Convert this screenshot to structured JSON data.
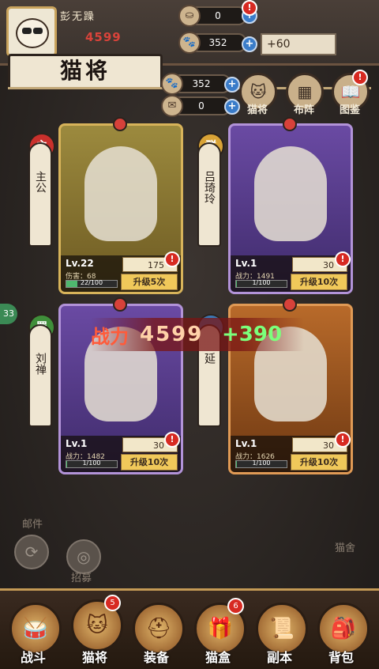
{
  "player": {
    "name": "彭无躁",
    "power": "4599"
  },
  "resources_top": [
    {
      "icon": "currency-icon",
      "value": "0"
    },
    {
      "icon": "cat-coin-icon",
      "value": "352"
    }
  ],
  "gain_text": "+60",
  "page_title": "猫将",
  "resources_mid": [
    {
      "icon": "cat-coin-icon",
      "value": "352"
    },
    {
      "icon": "scroll-icon",
      "value": "0"
    }
  ],
  "menu": [
    {
      "label": "猫将",
      "icon": "cat-head-icon"
    },
    {
      "label": "布阵",
      "icon": "formation-grid-icon"
    },
    {
      "label": "图鉴",
      "icon": "handbook-icon"
    }
  ],
  "heroes": [
    {
      "name": "主公",
      "faction": "主",
      "faction_color": "#c9302c",
      "level": "Lv.22",
      "stat": "伤害：68",
      "progress": "22/100",
      "progress_value": 0.22,
      "cost": "175",
      "upgrade": "升级5次",
      "theme": "gold"
    },
    {
      "name": "吕琦玲",
      "faction": "群",
      "faction_color": "#d9a336",
      "level": "Lv.1",
      "stat": "战力：1491",
      "progress": "1/100",
      "progress_value": 0.01,
      "cost": "30",
      "upgrade": "升级10次",
      "theme": "purple"
    },
    {
      "name": "刘禅",
      "faction": "蜀",
      "faction_color": "#3f8f3a",
      "level": "Lv.1",
      "stat": "战力：1482",
      "progress": "1/100",
      "progress_value": 0.01,
      "cost": "30",
      "upgrade": "升级10次",
      "theme": "purple"
    },
    {
      "name": "延",
      "faction": "",
      "faction_color": "#3b78b5",
      "level": "Lv.1",
      "stat": "战力：1626",
      "progress": "1/100",
      "progress_value": 0.01,
      "cost": "30",
      "upgrade": "升级10次",
      "theme": "orange"
    }
  ],
  "power_popup": {
    "label": "战力",
    "value": "4599",
    "delta": "+390"
  },
  "left_badge": "33",
  "side_actions": [
    {
      "label": "邮件",
      "icon": "mail-icon"
    },
    {
      "label": "招募",
      "icon": "recruit-icon"
    }
  ],
  "right_side_label": "猫舍",
  "nav": [
    {
      "label": "战斗",
      "icon": "battle-drum-icon",
      "badge": ""
    },
    {
      "label": "猫将",
      "icon": "cat-general-icon",
      "badge": "5"
    },
    {
      "label": "装备",
      "icon": "helmet-icon",
      "badge": ""
    },
    {
      "label": "猫盒",
      "icon": "treasure-chest-icon",
      "badge": "6"
    },
    {
      "label": "副本",
      "icon": "scroll-map-icon",
      "badge": ""
    },
    {
      "label": "背包",
      "icon": "backpack-icon",
      "badge": ""
    }
  ]
}
